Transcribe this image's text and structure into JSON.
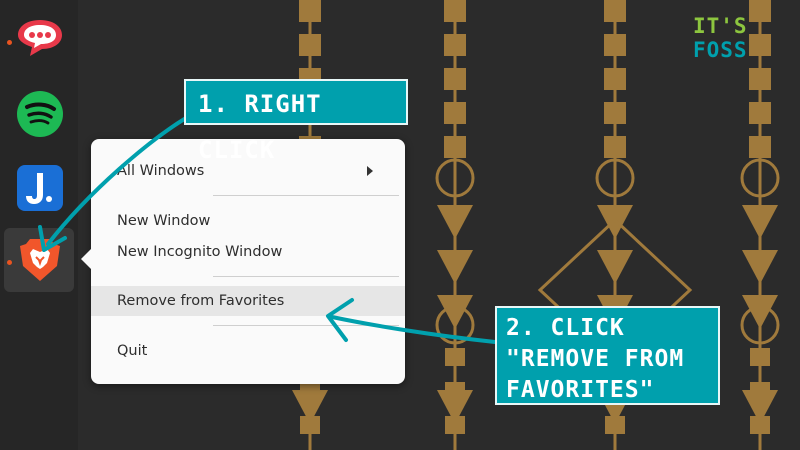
{
  "context_menu": {
    "items": [
      {
        "label": "All Windows",
        "has_submenu": true
      },
      {
        "label": "New Window"
      },
      {
        "label": "New Incognito Window"
      },
      {
        "label": "Remove from Favorites",
        "highlighted": true
      },
      {
        "label": "Quit"
      }
    ]
  },
  "dock": {
    "apps": [
      {
        "icon": "rocket-chat-icon",
        "running": true
      },
      {
        "icon": "spotify-icon",
        "running": false
      },
      {
        "icon": "joplin-icon",
        "running": false
      },
      {
        "icon": "brave-browser-icon",
        "running": true,
        "active": true
      }
    ]
  },
  "annotations": {
    "step1": "1. RIGHT CLICK",
    "step2_lines": [
      "2. CLICK",
      "\"REMOVE FROM",
      "FAVORITES\""
    ]
  },
  "logo": {
    "part1": "IT'S",
    "part2": "FOSS"
  },
  "colors": {
    "accent_teal": "#00a0ad",
    "logo_green": "#8dc63f",
    "wallpaper_gold": "#a07a3c",
    "dock_dot": "#e95420"
  }
}
